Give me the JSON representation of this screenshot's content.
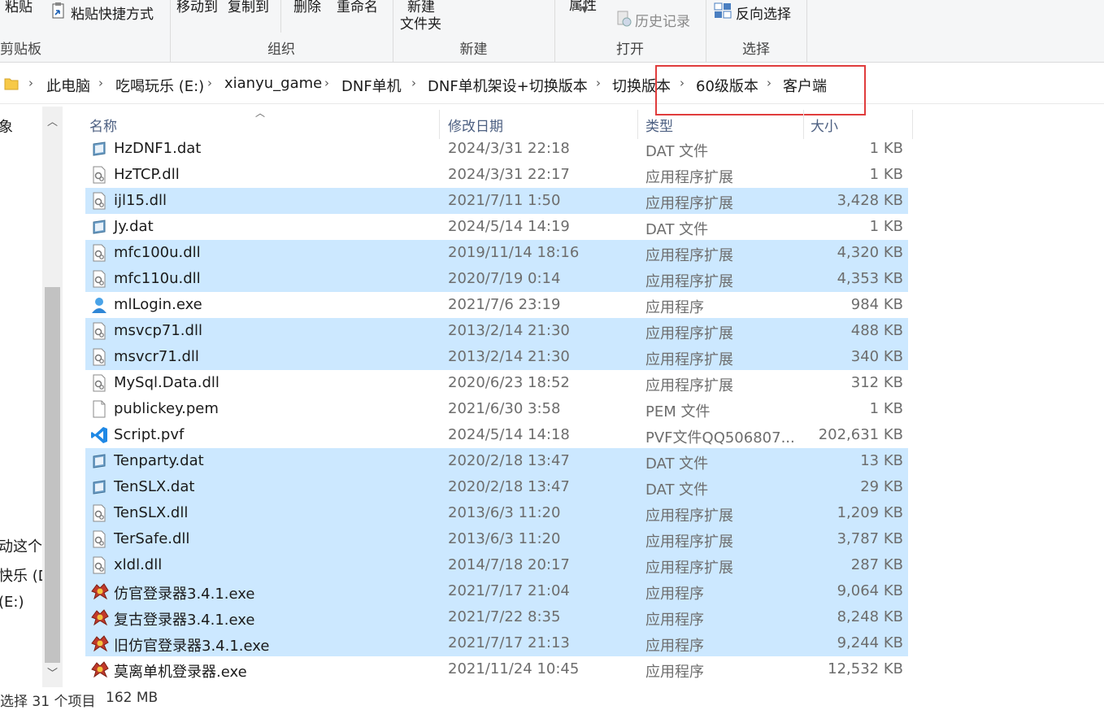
{
  "ribbon": {
    "clipboard": {
      "name": "剪贴板",
      "paste": "粘贴",
      "paste_shortcut": "粘贴快捷方式"
    },
    "organize": {
      "name": "组织",
      "move_to": "移动到",
      "copy_to": "复制到",
      "delete": "删除",
      "rename": "重命名"
    },
    "new": {
      "name": "新建",
      "new_folder_line1": "新建",
      "new_folder_line2": "文件夹"
    },
    "open": {
      "name": "打开",
      "properties": "属性",
      "history": "历史记录"
    },
    "select": {
      "name": "选择",
      "invert": "反向选择"
    }
  },
  "address": {
    "crumbs": [
      "此电脑",
      "吃喝玩乐 (E:)",
      "xianyu_game",
      "DNF单机",
      "DNF单机架设+切换版本",
      "切换版本",
      "60级版本",
      "客户端"
    ]
  },
  "nav": {
    "top_partial": "象",
    "items_partial": [
      "动这个",
      "快乐 (D",
      "(E:)"
    ]
  },
  "columns": {
    "name": "名称",
    "date": "修改日期",
    "type": "类型",
    "size": "大小"
  },
  "files": [
    {
      "name": "HzDNF1.dat",
      "date": "2024/3/31 22:18",
      "type": "DAT 文件",
      "size": "1 KB",
      "icon": "dat-icon",
      "selected": false
    },
    {
      "name": "HzTCP.dll",
      "date": "2024/3/31 22:17",
      "type": "应用程序扩展",
      "size": "1 KB",
      "icon": "dll-icon",
      "selected": false
    },
    {
      "name": "ijl15.dll",
      "date": "2021/7/11 1:50",
      "type": "应用程序扩展",
      "size": "3,428 KB",
      "icon": "dll-icon",
      "selected": true
    },
    {
      "name": "Jy.dat",
      "date": "2024/5/14 14:19",
      "type": "DAT 文件",
      "size": "1 KB",
      "icon": "dat-icon",
      "selected": false
    },
    {
      "name": "mfc100u.dll",
      "date": "2019/11/14 18:16",
      "type": "应用程序扩展",
      "size": "4,320 KB",
      "icon": "dll-icon",
      "selected": true
    },
    {
      "name": "mfc110u.dll",
      "date": "2020/7/19 0:14",
      "type": "应用程序扩展",
      "size": "4,353 KB",
      "icon": "dll-icon",
      "selected": true
    },
    {
      "name": "mlLogin.exe",
      "date": "2021/7/6 23:19",
      "type": "应用程序",
      "size": "984 KB",
      "icon": "user-icon",
      "selected": false
    },
    {
      "name": "msvcp71.dll",
      "date": "2013/2/14 21:30",
      "type": "应用程序扩展",
      "size": "488 KB",
      "icon": "dll-icon",
      "selected": true
    },
    {
      "name": "msvcr71.dll",
      "date": "2013/2/14 21:30",
      "type": "应用程序扩展",
      "size": "340 KB",
      "icon": "dll-icon",
      "selected": true
    },
    {
      "name": "MySql.Data.dll",
      "date": "2020/6/23 18:52",
      "type": "应用程序扩展",
      "size": "312 KB",
      "icon": "dll-icon",
      "selected": false
    },
    {
      "name": "publickey.pem",
      "date": "2021/6/30 3:58",
      "type": "PEM 文件",
      "size": "1 KB",
      "icon": "blank-file-icon",
      "selected": false
    },
    {
      "name": "Script.pvf",
      "date": "2024/5/14 14:18",
      "type": "PVF文件QQ506807...",
      "size": "202,631 KB",
      "icon": "vscode-icon",
      "selected": false
    },
    {
      "name": "Tenparty.dat",
      "date": "2020/2/18 13:47",
      "type": "DAT 文件",
      "size": "13 KB",
      "icon": "dat-icon",
      "selected": true
    },
    {
      "name": "TenSLX.dat",
      "date": "2020/2/18 13:47",
      "type": "DAT 文件",
      "size": "29 KB",
      "icon": "dat-icon",
      "selected": true
    },
    {
      "name": "TenSLX.dll",
      "date": "2013/6/3 11:20",
      "type": "应用程序扩展",
      "size": "1,209 KB",
      "icon": "dll-icon",
      "selected": true
    },
    {
      "name": "TerSafe.dll",
      "date": "2013/6/3 11:20",
      "type": "应用程序扩展",
      "size": "3,787 KB",
      "icon": "dll-icon",
      "selected": true
    },
    {
      "name": "xldl.dll",
      "date": "2014/7/18 20:17",
      "type": "应用程序扩展",
      "size": "287 KB",
      "icon": "dll-icon",
      "selected": true
    },
    {
      "name": "仿官登录器3.4.1.exe",
      "date": "2021/7/17 21:04",
      "type": "应用程序",
      "size": "9,064 KB",
      "icon": "game-exe-icon",
      "selected": true
    },
    {
      "name": "复古登录器3.4.1.exe",
      "date": "2021/7/22 8:35",
      "type": "应用程序",
      "size": "8,248 KB",
      "icon": "game-exe-icon",
      "selected": true
    },
    {
      "name": "旧仿官登录器3.4.1.exe",
      "date": "2021/7/17 21:13",
      "type": "应用程序",
      "size": "9,244 KB",
      "icon": "game-exe-icon",
      "selected": true
    },
    {
      "name": "莫离单机登录器.exe",
      "date": "2021/11/24 10:45",
      "type": "应用程序",
      "size": "12,532 KB",
      "icon": "game-exe-icon",
      "selected": false
    }
  ],
  "status": {
    "selection": "选择 31 个项目",
    "size": "162 MB"
  },
  "colors": {
    "selected_row": "#cce8ff",
    "highlight_box": "#e03c3c",
    "header_text": "#4d6082"
  }
}
